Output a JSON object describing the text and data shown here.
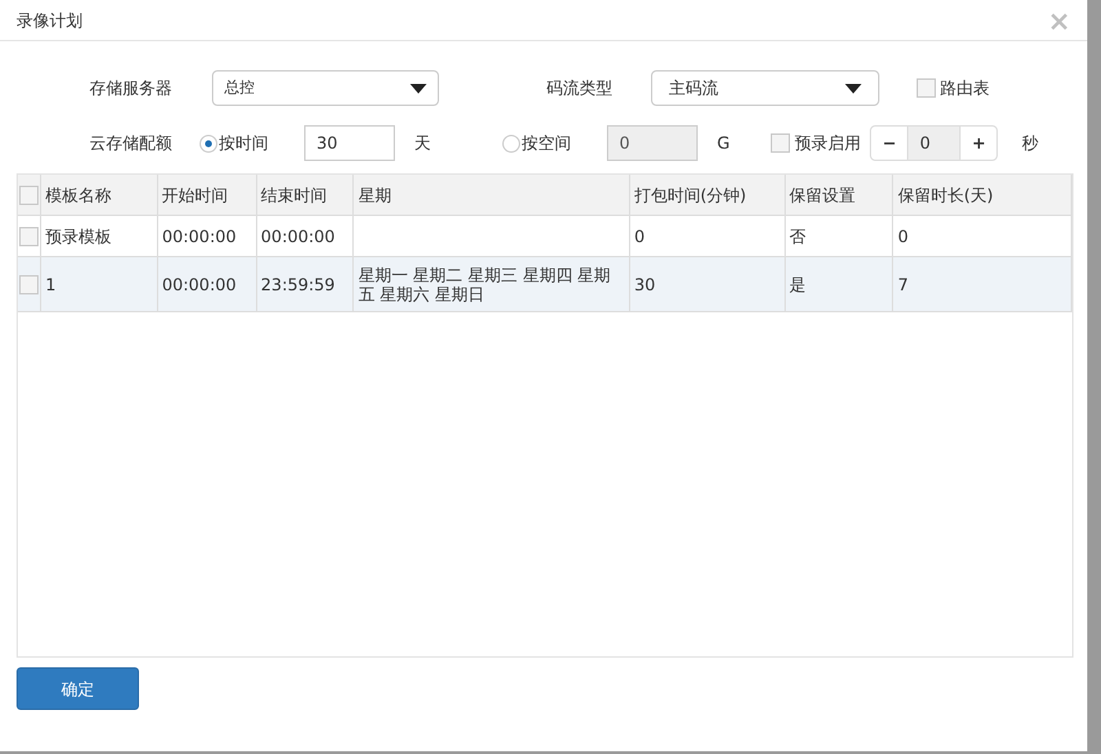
{
  "window": {
    "title": "录像计划",
    "close": "×"
  },
  "form": {
    "storage_server": {
      "label": "存储服务器",
      "value": "总控"
    },
    "stream_type": {
      "label": "码流类型",
      "value": "主码流"
    },
    "routing_table": {
      "label": "路由表",
      "checked": false
    },
    "quota": {
      "label": "云存储配额",
      "options": [
        {
          "label": "按时间",
          "selected": true,
          "value": "30",
          "unit": "天",
          "disabled": false
        },
        {
          "label": "按空间",
          "selected": false,
          "value": "0",
          "unit": "G",
          "disabled": true
        }
      ]
    },
    "prerecord": {
      "label": "预录启用",
      "checked": false,
      "minus": "−",
      "value": "0",
      "plus": "+",
      "unit": "秒"
    }
  },
  "table": {
    "select_all": {
      "checked": false
    },
    "columns": [
      "模板名称",
      "开始时间",
      "结束时间",
      "星期",
      "打包时间(分钟)",
      "保留设置",
      "保留时长(天)"
    ],
    "rows": [
      {
        "checked": false,
        "cells": [
          "预录模板",
          "00:00:00",
          "00:00:00",
          "",
          "0",
          "否",
          "0"
        ]
      },
      {
        "checked": false,
        "cells": [
          "1",
          "00:00:00",
          "23:59:59",
          "星期一 星期二 星期三 星期四 星期五 星期六 星期日",
          "30",
          "是",
          "7"
        ]
      }
    ]
  },
  "buttons": [
    {
      "label": "确定"
    }
  ]
}
